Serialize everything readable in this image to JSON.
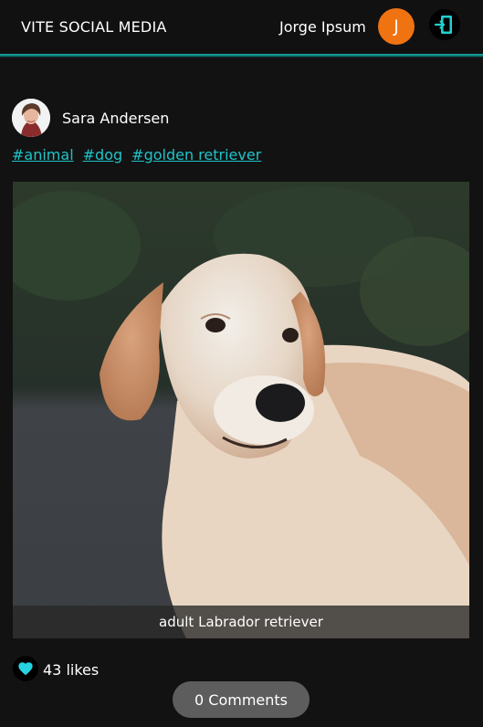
{
  "header": {
    "brand": "VITE SOCIAL MEDIA",
    "username": "Jorge Ipsum",
    "avatar_initial": "J",
    "avatar_color": "#f07312",
    "accent_color": "#1ab7b0",
    "logout_icon": "logout-door-icon"
  },
  "post": {
    "author": "Sara Andersen",
    "tags": [
      "#animal",
      "#dog",
      "#golden retriever"
    ],
    "image_caption": "adult Labrador retriever",
    "likes_count": "43",
    "likes_label": "likes",
    "like_icon": "heart-icon",
    "comments_label": "0 Comments"
  }
}
